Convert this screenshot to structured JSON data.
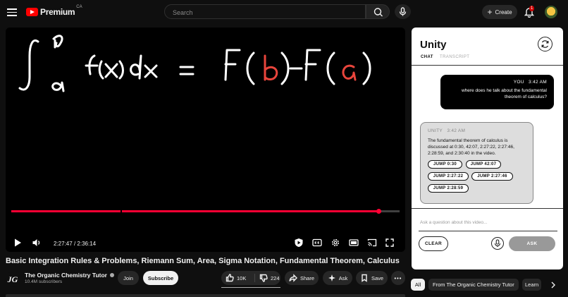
{
  "header": {
    "brand": "Premium",
    "region": "CA",
    "search_placeholder": "Search",
    "create_label": "Create",
    "notification_count": "1"
  },
  "player": {
    "current_time": "2:27:47",
    "duration": "2:36:14",
    "time_separator": "/",
    "progress_fraction": 0.946
  },
  "video": {
    "title": "Basic Integration Rules & Problems, Riemann Sum, Area, Sigma Notation, Fundamental Theorem, Calculus",
    "channel": "The Organic Chemistry Tutor",
    "channel_initials": "JG",
    "subscribers": "10.4M subscribers",
    "join_label": "Join",
    "subscribe_label": "Subscribe",
    "likes": "10K",
    "dislikes": "224",
    "share_label": "Share",
    "ask_label": "Ask",
    "save_label": "Save"
  },
  "panel": {
    "title": "Unity",
    "tabs": [
      "CHAT",
      "TRANSCRIPT"
    ],
    "user_message": {
      "sender": "YOU",
      "time": "3:42 AM",
      "text": "where does he talk about the fundamental theorem of calculus?"
    },
    "bot_message": {
      "sender": "UNITY",
      "time": "3:42 AM",
      "text": "The fundamental theorem of calculus is discussed at 0:30, 42:07, 2:27:22, 2:27:46, 2:28:59, and 2:30:40 in the video.",
      "jumps": [
        "JUMP 0:30",
        "JUMP 42:07",
        "JUMP 2:27:22",
        "JUMP 2:27:46",
        "JUMP 2:28:59"
      ]
    },
    "ask_placeholder": "Ask a question about this video...",
    "clear_label": "CLEAR",
    "ask_button_label": "ASK"
  },
  "chips": [
    "All",
    "From The Organic Chemistry Tutor",
    "Learn"
  ],
  "colors": {
    "accent": "#ff0033",
    "brand_red": "#ff0000",
    "background": "#0f0f0f"
  }
}
